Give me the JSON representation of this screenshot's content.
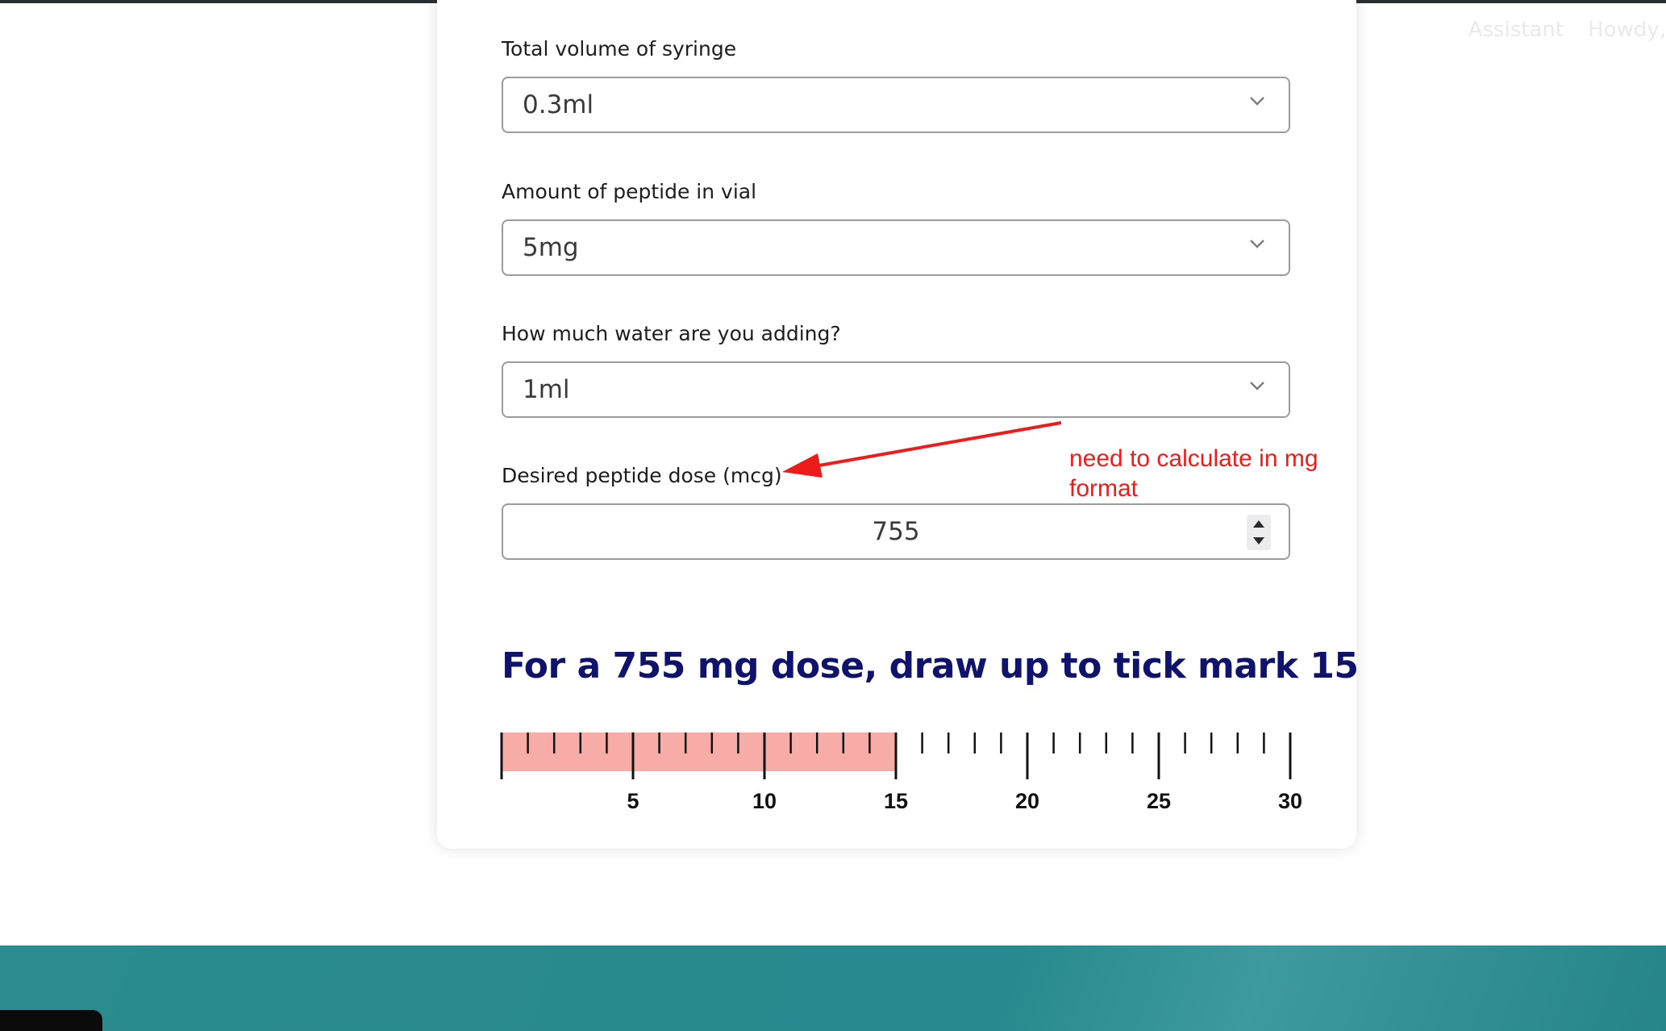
{
  "top_nav": {
    "items": [
      "Assistant",
      "Howdy,"
    ]
  },
  "calculator": {
    "fields": [
      {
        "label": "Total volume of syringe",
        "value": "0.3ml"
      },
      {
        "label": "Amount of peptide in vial",
        "value": "5mg"
      },
      {
        "label": "How much water are you adding?",
        "value": "1ml"
      }
    ],
    "dose": {
      "label": "Desired peptide dose (mcg)",
      "value": "755"
    },
    "result_heading": "For a 755 mg dose, draw up to tick mark 15",
    "syringe": {
      "tick_labels": [
        "5",
        "10",
        "15",
        "20",
        "25",
        "30"
      ],
      "filled_to": 15,
      "max": 30,
      "fill_color": "#f8aca7"
    }
  },
  "annotation": {
    "text_line1": "need to calculate in mg",
    "text_line2": "format",
    "color": "#ee1b1b"
  },
  "colors": {
    "heading": "#10136b",
    "footer": "#2b8b8f"
  }
}
